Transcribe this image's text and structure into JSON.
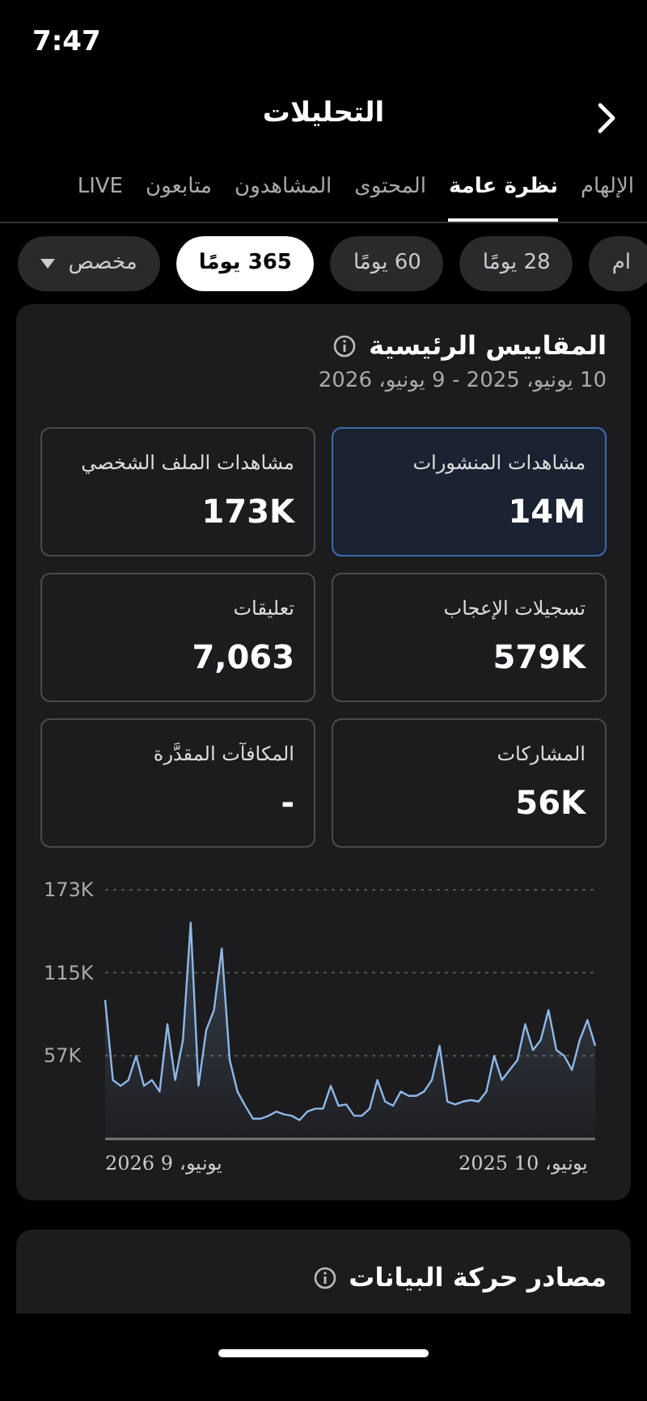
{
  "status_bar": {
    "time": "7:47"
  },
  "header": {
    "title": "التحليلات"
  },
  "tabs": [
    {
      "label": "الإلهام",
      "selected": false
    },
    {
      "label": "نظرة عامة",
      "selected": true
    },
    {
      "label": "المحتوى",
      "selected": false
    },
    {
      "label": "المشاهدون",
      "selected": false
    },
    {
      "label": "متابعون",
      "selected": false
    },
    {
      "label": "LIVE",
      "selected": false
    }
  ],
  "ranges": [
    {
      "label": "ام",
      "kind": "chip",
      "selected": false
    },
    {
      "label": "28 يومًا",
      "kind": "chip",
      "selected": false
    },
    {
      "label": "60 يومًا",
      "kind": "chip",
      "selected": false
    },
    {
      "label": "365 يومًا",
      "kind": "chip",
      "selected": true
    },
    {
      "label": "مخصص",
      "kind": "dropdown",
      "selected": false
    }
  ],
  "key_metrics": {
    "title": "المقاييس الرئيسية",
    "date_range": "10 يونيو، 2025 - 9 يونيو، 2026",
    "metrics": [
      {
        "label": "مشاهدات المنشورات",
        "value": "14M",
        "selected": true
      },
      {
        "label": "مشاهدات الملف الشخصي",
        "value": "173K",
        "selected": false
      },
      {
        "label": "تسجيلات الإعجاب",
        "value": "579K",
        "selected": false
      },
      {
        "label": "تعليقات",
        "value": "7,063",
        "selected": false
      },
      {
        "label": "المشاركات",
        "value": "56K",
        "selected": false
      },
      {
        "label": "المكافآت المقدَّرة",
        "value": "-",
        "selected": false
      }
    ],
    "chart_data": {
      "type": "area",
      "ylim": [
        0,
        173
      ],
      "yticks": [
        {
          "value": 57,
          "label": "57K"
        },
        {
          "value": 115,
          "label": "115K"
        },
        {
          "value": 173,
          "label": "173K"
        }
      ],
      "series": [
        {
          "color": "#8fb8e8",
          "values": [
            96,
            40,
            36,
            40,
            57,
            36,
            40,
            32,
            79,
            40,
            68,
            150,
            36,
            75,
            89,
            132,
            54,
            32,
            22,
            13,
            13,
            15,
            18,
            16,
            15,
            12,
            18,
            20,
            20,
            36,
            22,
            23,
            15,
            15,
            20,
            40,
            25,
            22,
            32,
            29,
            29,
            32,
            40,
            64,
            25,
            23,
            25,
            26,
            25,
            32,
            57,
            40,
            47,
            54,
            79,
            61,
            68,
            89,
            61,
            57,
            47,
            68,
            82,
            64
          ]
        }
      ]
    },
    "x_axis_labels": [
      "يونيو، 10 2025",
      "يونيو، 9 2026"
    ]
  },
  "traffic_sources": {
    "title": "مصادر حركة البيانات"
  }
}
